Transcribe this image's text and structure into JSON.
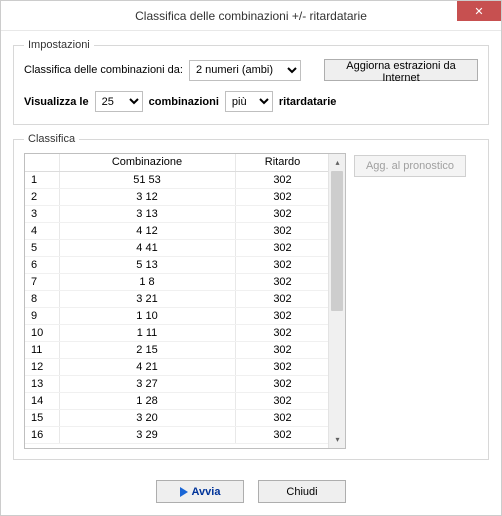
{
  "window": {
    "title": "Classifica delle combinazioni +/- ritardatarie",
    "close_label": "✕"
  },
  "settings": {
    "legend": "Impostazioni",
    "classifica_label": "Classifica delle combinazioni da:",
    "classifica_value": "2 numeri (ambi)",
    "aggiorna_label": "Aggiorna estrazioni da Internet",
    "visualizza_prefix": "Visualizza le",
    "count_value": "25",
    "combinazioni_label": "combinazioni",
    "mode_value": "più",
    "ritardatarie_label": "ritardatarie"
  },
  "classifica": {
    "legend": "Classifica",
    "agg_pronostico_label": "Agg. al pronostico",
    "headers": {
      "idx": "",
      "combinazione": "Combinazione",
      "ritardo": "Ritardo"
    },
    "rows": [
      {
        "i": "1",
        "c": "51 53",
        "r": "302"
      },
      {
        "i": "2",
        "c": "3 12",
        "r": "302"
      },
      {
        "i": "3",
        "c": "3 13",
        "r": "302"
      },
      {
        "i": "4",
        "c": "4 12",
        "r": "302"
      },
      {
        "i": "5",
        "c": "4 41",
        "r": "302"
      },
      {
        "i": "6",
        "c": "5 13",
        "r": "302"
      },
      {
        "i": "7",
        "c": "1 8",
        "r": "302"
      },
      {
        "i": "8",
        "c": "3 21",
        "r": "302"
      },
      {
        "i": "9",
        "c": "1 10",
        "r": "302"
      },
      {
        "i": "10",
        "c": "1 11",
        "r": "302"
      },
      {
        "i": "11",
        "c": "2 15",
        "r": "302"
      },
      {
        "i": "12",
        "c": "4 21",
        "r": "302"
      },
      {
        "i": "13",
        "c": "3 27",
        "r": "302"
      },
      {
        "i": "14",
        "c": "1 28",
        "r": "302"
      },
      {
        "i": "15",
        "c": "3 20",
        "r": "302"
      },
      {
        "i": "16",
        "c": "3 29",
        "r": "302"
      }
    ]
  },
  "buttons": {
    "avvia": "Avvia",
    "chiudi": "Chiudi"
  }
}
